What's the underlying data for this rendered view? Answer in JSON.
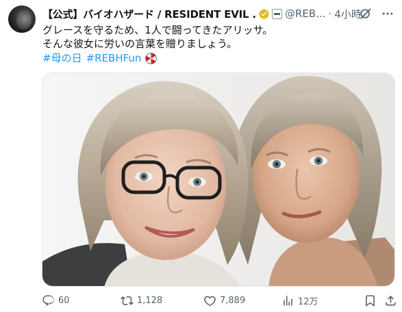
{
  "author": {
    "name": "【公式】バイオハザード / RESIDENT EVIL ...",
    "handle": "@REB...",
    "time": "4小時"
  },
  "separator": "·",
  "tweet": {
    "lines": [
      "グレースを守るため、1人で闘ってきたアリッサ。",
      "そんな彼女に労いの言葉を贈りましょう。"
    ],
    "hashtags": [
      "#母の日",
      "#REBHFun"
    ]
  },
  "metrics": {
    "replies": "60",
    "retweets": "1,128",
    "likes": "7,889",
    "views": "12万"
  },
  "colors": {
    "link": "#1d9bf0",
    "muted": "#536471",
    "verified": "#e2b719",
    "umbrella_red": "#d01f2a"
  },
  "icons": {
    "verified": "verified-badge-icon",
    "affiliate": "affiliate-badge-icon",
    "grok": "grok-icon",
    "more": "more-icon",
    "reply": "reply-icon",
    "retweet": "retweet-icon",
    "like": "heart-icon",
    "views": "views-icon",
    "bookmark": "bookmark-icon",
    "share": "share-icon",
    "umbrella": "umbrella-logo-icon"
  }
}
